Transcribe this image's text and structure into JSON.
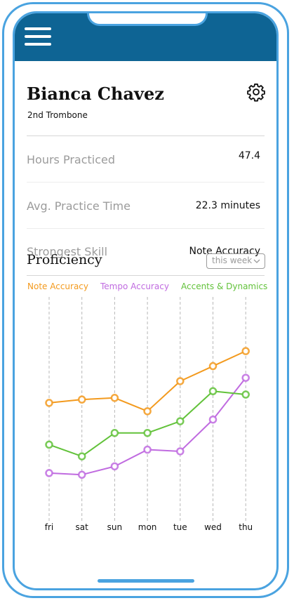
{
  "profile": {
    "name": "Bianca Chavez",
    "role": "2nd Trombone"
  },
  "icons": {
    "menu": "hamburger-menu-icon",
    "settings": "gear-icon",
    "dropdown": "chevron-down-icon"
  },
  "colors": {
    "header": "#0e6494",
    "frame": "#4aa3e0"
  },
  "stats": [
    {
      "label": "Hours Practiced",
      "value": "47.4"
    },
    {
      "label": "Avg. Practice Time",
      "value": "22.3 minutes"
    },
    {
      "label": "Strongest Skill",
      "value": "Note Accuracy"
    }
  ],
  "proficiency": {
    "title": "Proficiency",
    "range_selected": "this week"
  },
  "chart_data": {
    "type": "line",
    "categories": [
      "fri",
      "sat",
      "sun",
      "mon",
      "tue",
      "wed",
      "thu"
    ],
    "ylim": [
      0,
      100
    ],
    "grid": "vertical dashed",
    "legend": "top",
    "series": [
      {
        "name": "Note Accuracy",
        "color": "#f39a1e",
        "values": [
          66,
          68,
          69,
          61,
          79,
          88,
          97
        ]
      },
      {
        "name": "Tempo Accuracy",
        "color": "#c06be0",
        "values": [
          24,
          23,
          28,
          38,
          37,
          56,
          81
        ]
      },
      {
        "name": "Accents & Dynamics",
        "color": "#62c23a",
        "values": [
          41,
          34,
          48,
          48,
          55,
          73,
          71
        ]
      }
    ]
  }
}
